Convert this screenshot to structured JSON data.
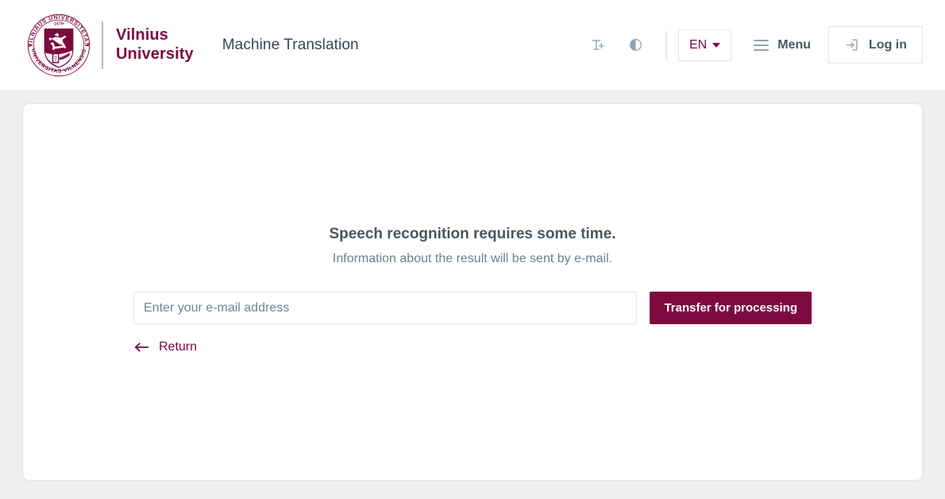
{
  "header": {
    "logo": {
      "seal_top_text": "VILNIAUS UNIVERSITETAS",
      "seal_bottom_text": "UNIVERSITAS VILNENSIS",
      "seal_year": "1579",
      "wordmark": "Vilnius\nUniversity"
    },
    "app_title": "Machine Translation",
    "text_size_icon": "text-size-increase-icon",
    "contrast_icon": "contrast-toggle-icon",
    "language": {
      "selected": "EN",
      "caret_icon": "chevron-down-icon"
    },
    "menu": {
      "label": "Menu",
      "icon": "hamburger-menu-icon"
    },
    "login": {
      "label": "Log in",
      "icon": "sign-in-icon"
    }
  },
  "main": {
    "headline": "Speech recognition requires some time.",
    "subline": "Information about the result will be sent by e-mail.",
    "email_field": {
      "placeholder": "Enter your e-mail address",
      "value": ""
    },
    "submit_label": "Transfer for processing",
    "return": {
      "label": "Return",
      "icon": "arrow-left-icon"
    }
  },
  "colors": {
    "brand_maroon": "#7d0a3f",
    "page_background": "#eeeeee",
    "card_background": "#ffffff",
    "text_primary": "#4c5562",
    "text_secondary": "#737d89",
    "icon_gray": "#97a1ad",
    "border": "#e2e2e2"
  }
}
